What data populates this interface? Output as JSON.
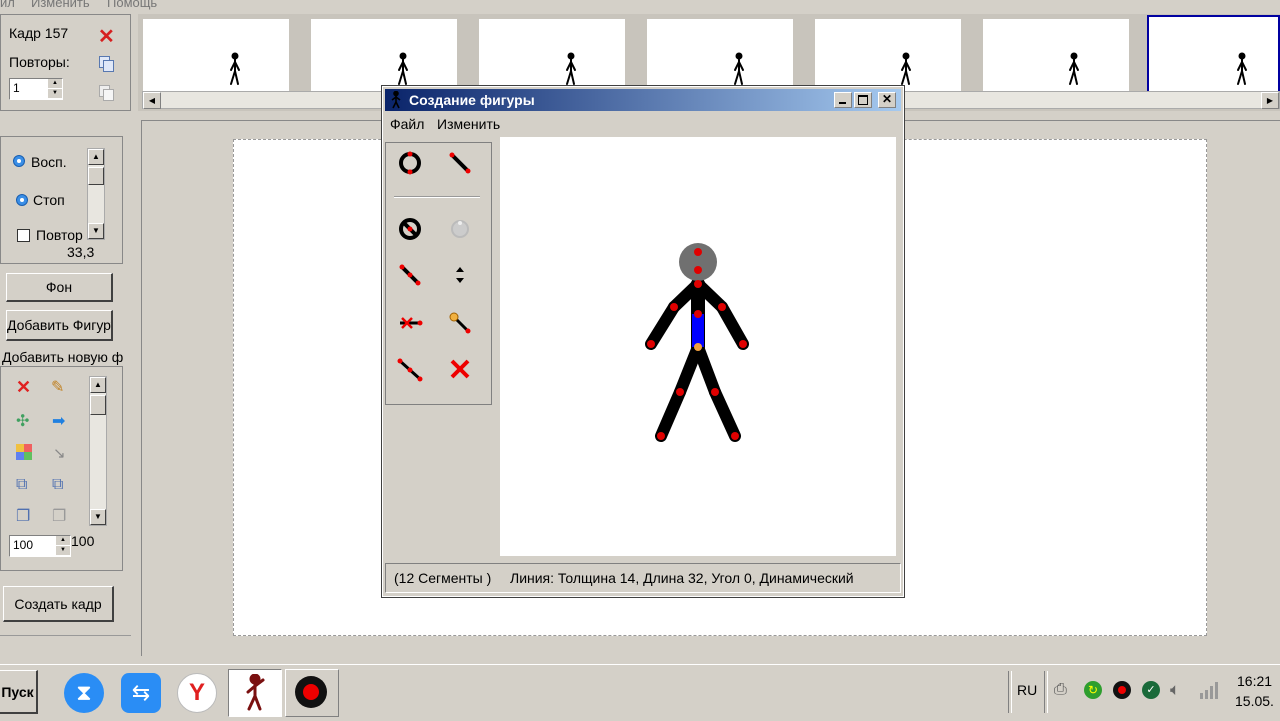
{
  "menu": {
    "items": [
      "ил",
      "Изменить",
      "Помощь"
    ]
  },
  "frame_panel": {
    "frame_label": "Кадр 157",
    "repeats_label": "Повторы:",
    "repeats_value": "1"
  },
  "playback": {
    "play": "Восп.",
    "stop": "Стоп",
    "repeat": "Повтор",
    "fps": "33,3"
  },
  "left_buttons": {
    "background": "Фон",
    "add_figure": "Добавить Фигуру",
    "add_new": "Добавить новую ф"
  },
  "size": {
    "value": "100",
    "label": "100"
  },
  "create_frame": "Создать кадр",
  "dialog": {
    "title": "Создание фигуры",
    "menu": [
      "Файл",
      "Изменить"
    ],
    "status_segments": "(12 Сегменты )",
    "status_line": "Линия: Толщина 14, Длина 32, Угол 0, Динамический"
  },
  "taskbar": {
    "start": "Пуск",
    "lang": "RU",
    "time": "16:21",
    "date": "15.05."
  },
  "colors": {
    "title_start": "#0a246a",
    "title_end": "#a6caf0",
    "handle": "#ff0000",
    "selected_limb": "#0000ff",
    "head": "#707070"
  }
}
